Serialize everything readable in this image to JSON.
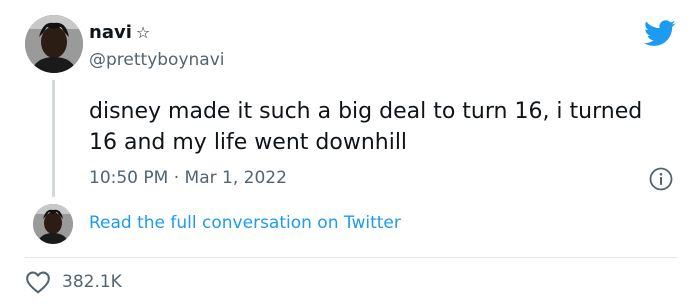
{
  "tweet": {
    "author_name": "navi",
    "author_badge": "☆",
    "handle": "@prettyboynavi",
    "text": "disney made it such a big deal to turn 16, i turned 16 and my life went downhill",
    "timestamp": "10:50 PM · Mar 1, 2022",
    "full_conversation_link": "Read the full conversation on Twitter",
    "likes": "382.1K"
  },
  "icons": {
    "brand": "twitter-bird-icon",
    "info": "info-icon",
    "like": "heart-icon"
  },
  "colors": {
    "brand_blue": "#1d9bf0",
    "secondary_text": "#536471",
    "primary_text": "#0f1419",
    "divider": "#e1e8ed"
  }
}
